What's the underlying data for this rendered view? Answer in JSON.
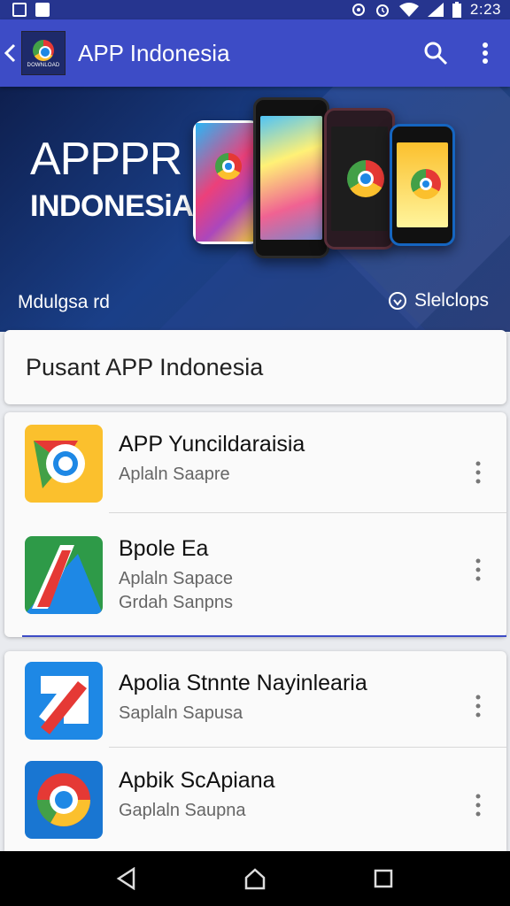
{
  "status_bar": {
    "time": "2:23",
    "left_icons": [
      "image-notification-icon",
      "download-notification-icon"
    ],
    "right_icons": [
      "sync-icon",
      "alarm-icon",
      "wifi-icon",
      "signal-icon",
      "battery-icon"
    ]
  },
  "app_bar": {
    "title": "APP Indonesia",
    "logo_text": "DOWNLOAD",
    "icons": [
      "back-arrow-icon",
      "search-icon",
      "more-vert-icon"
    ],
    "background": "#3d4cc6"
  },
  "banner": {
    "title": "APPPR",
    "subtitle": "INDONESiA A",
    "left_caption": "Mdulgsa rd",
    "right_caption": "Slelclops",
    "right_icon": "location-pin-icon"
  },
  "header_card": {
    "title": "Pusant APP Indonesia"
  },
  "lists": [
    {
      "items": [
        {
          "name": "APP Yuncildaraisia",
          "sub": "Aplaln Saapre",
          "sub2": "",
          "icon": "chrome-like-app-icon"
        },
        {
          "name": "Bpole Ea",
          "sub": "Aplaln Sapace",
          "sub2": "Grdah Sanpns",
          "icon": "triangle-app-icon"
        }
      ]
    },
    {
      "items": [
        {
          "name": "Apolia Stnnte Nayinlearia",
          "sub": "Saplaln Sapusa",
          "sub2": "",
          "icon": "arrow-app-icon"
        },
        {
          "name": "Apbik ScApiana",
          "sub": "Gaplaln Saupna",
          "sub2": "",
          "icon": "chrome-blue-app-icon"
        }
      ]
    }
  ],
  "nav_bar": {
    "icons": [
      "back-triangle-icon",
      "home-icon",
      "recents-square-icon"
    ]
  }
}
